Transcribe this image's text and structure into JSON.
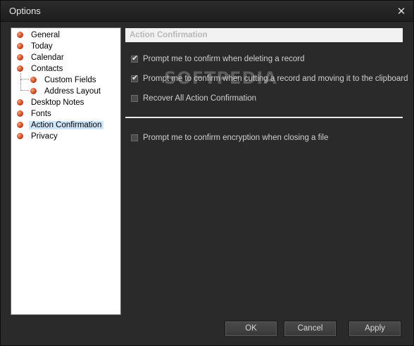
{
  "window": {
    "title": "Options"
  },
  "tree": {
    "items": [
      {
        "label": "General"
      },
      {
        "label": "Today"
      },
      {
        "label": "Calendar"
      },
      {
        "label": "Contacts"
      },
      {
        "label": "Custom Fields"
      },
      {
        "label": "Address Layout"
      },
      {
        "label": "Desktop Notes"
      },
      {
        "label": "Fonts"
      },
      {
        "label": "Action Confirmation",
        "selected": true
      },
      {
        "label": "Privacy"
      }
    ]
  },
  "panel": {
    "header": "Action Confirmation",
    "options": [
      {
        "label": "Prompt me to confirm when deleting a record",
        "checked": true
      },
      {
        "label": "Prompt me to confirm when cutting a record and moving it to the clipboard",
        "checked": true
      },
      {
        "label": "Recover All Action Confirmation",
        "checked": false
      },
      {
        "label": "Prompt me to confirm encryption when closing a file",
        "checked": false
      }
    ],
    "watermark": "SOFTPEDIA"
  },
  "buttons": {
    "ok": "OK",
    "cancel": "Cancel",
    "apply": "Apply"
  },
  "colors": {
    "accent_bullet": "#c8431d",
    "selection": "#cfe5fb",
    "background": "#2a2a2a"
  }
}
